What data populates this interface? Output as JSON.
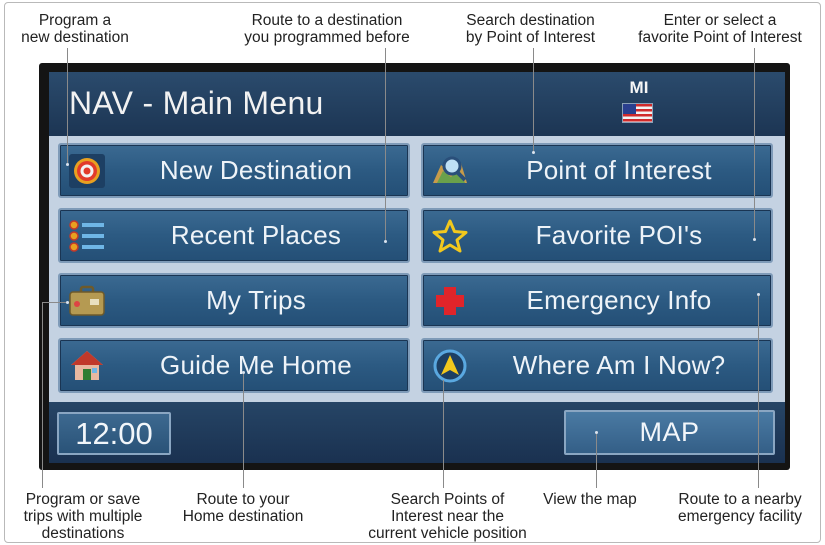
{
  "annotations": {
    "program_new": "Program a\nnew destination",
    "route_before": "Route to a destination\nyou programmed before",
    "search_poi": "Search destination\nby Point of Interest",
    "favorite_poi": "Enter or select a\nfavorite Point of Interest",
    "program_trips": "Program or save\ntrips with multiple\ndestinations",
    "route_home": "Route to your\nHome destination",
    "search_near": "Search Points of\nInterest near the\ncurrent vehicle position",
    "view_map": "View the map",
    "route_emergency": "Route to a nearby\nemergency facility"
  },
  "header": {
    "title": "NAV - Main Menu",
    "state": "MI",
    "flag_icon": "us-flag-icon"
  },
  "menu": {
    "new_destination": "New Destination",
    "point_of_interest": "Point of Interest",
    "recent_places": "Recent Places",
    "favorite_pois": "Favorite POI's",
    "my_trips": "My Trips",
    "emergency_info": "Emergency Info",
    "guide_me_home": "Guide Me Home",
    "where_am_i_now": "Where Am I Now?"
  },
  "footer": {
    "clock": "12:00",
    "map": "MAP"
  },
  "colors": {
    "display_bg": "#1f3a58",
    "button_bg": "#2c5a82",
    "button_border": "#7f9bb8",
    "menu_bg": "#c4d2e2",
    "text": "#eef3f8"
  }
}
